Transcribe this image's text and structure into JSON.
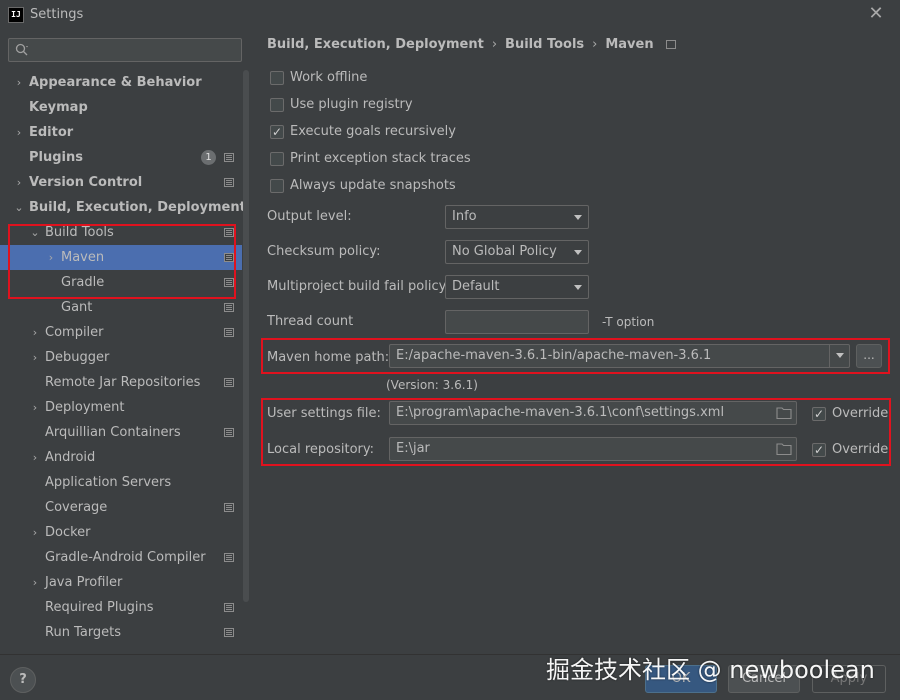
{
  "window": {
    "title": "Settings",
    "app_icon_text": "IJ",
    "close_glyph": "✕"
  },
  "sidebar": {
    "search_placeholder": "",
    "items": [
      {
        "label": "Appearance & Behavior",
        "arrow": "›",
        "bold": true
      },
      {
        "label": "Keymap",
        "arrow": "",
        "bold": true
      },
      {
        "label": "Editor",
        "arrow": "›",
        "bold": true
      },
      {
        "label": "Plugins",
        "arrow": "",
        "bold": true,
        "badge": "1"
      },
      {
        "label": "Version Control",
        "arrow": "›",
        "bold": true
      },
      {
        "label": "Build, Execution, Deployment",
        "arrow": "⌄",
        "bold": true
      },
      {
        "label": "Build Tools",
        "arrow": "⌄",
        "bold": false
      },
      {
        "label": "Maven",
        "arrow": "›",
        "bold": false,
        "selected": true
      },
      {
        "label": "Gradle",
        "arrow": "",
        "bold": false
      },
      {
        "label": "Gant",
        "arrow": "",
        "bold": false
      },
      {
        "label": "Compiler",
        "arrow": "›",
        "bold": false
      },
      {
        "label": "Debugger",
        "arrow": "›",
        "bold": false
      },
      {
        "label": "Remote Jar Repositories",
        "arrow": "",
        "bold": false
      },
      {
        "label": "Deployment",
        "arrow": "›",
        "bold": false
      },
      {
        "label": "Arquillian Containers",
        "arrow": "",
        "bold": false
      },
      {
        "label": "Android",
        "arrow": "›",
        "bold": false
      },
      {
        "label": "Application Servers",
        "arrow": "",
        "bold": false
      },
      {
        "label": "Coverage",
        "arrow": "",
        "bold": false
      },
      {
        "label": "Docker",
        "arrow": "›",
        "bold": false
      },
      {
        "label": "Gradle-Android Compiler",
        "arrow": "",
        "bold": false
      },
      {
        "label": "Java Profiler",
        "arrow": "›",
        "bold": false
      },
      {
        "label": "Required Plugins",
        "arrow": "",
        "bold": false
      },
      {
        "label": "Run Targets",
        "arrow": "",
        "bold": false
      }
    ]
  },
  "breadcrumb": {
    "parts": [
      "Build, Execution, Deployment",
      "Build Tools",
      "Maven"
    ],
    "separator": "›"
  },
  "checkboxes": [
    {
      "label": "Work offline",
      "checked": false
    },
    {
      "label": "Use plugin registry",
      "checked": false
    },
    {
      "label": "Execute goals recursively",
      "checked": true
    },
    {
      "label": "Print exception stack traces",
      "checked": false
    },
    {
      "label": "Always update snapshots",
      "checked": false
    }
  ],
  "fields": {
    "output_level": {
      "label": "Output level:",
      "value": "Info"
    },
    "checksum_policy": {
      "label": "Checksum policy:",
      "value": "No Global Policy"
    },
    "multiproject_fail": {
      "label": "Multiproject build fail policy:",
      "value": "Default"
    },
    "thread_count": {
      "label": "Thread count",
      "value": "",
      "note": "-T option"
    },
    "maven_home": {
      "label": "Maven home path:",
      "value": "E:/apache-maven-3.6.1-bin/apache-maven-3.6.1",
      "button": "...",
      "version": "(Version: 3.6.1)"
    },
    "user_settings": {
      "label": "User settings file:",
      "value": "E:\\program\\apache-maven-3.6.1\\conf\\settings.xml",
      "override_label": "Override",
      "override_checked": true
    },
    "local_repo": {
      "label": "Local repository:",
      "value": "E:\\jar",
      "override_label": "Override",
      "override_checked": true
    }
  },
  "buttons": {
    "help": "?",
    "ok": "OK",
    "cancel": "Cancel",
    "apply": "Apply"
  },
  "watermark": "掘金技术社区 @ newboolean",
  "colors": {
    "background": "#3c3f41",
    "selection": "#4b6eaf",
    "highlight_box": "#e0121e",
    "text": "#bbbbbb"
  }
}
